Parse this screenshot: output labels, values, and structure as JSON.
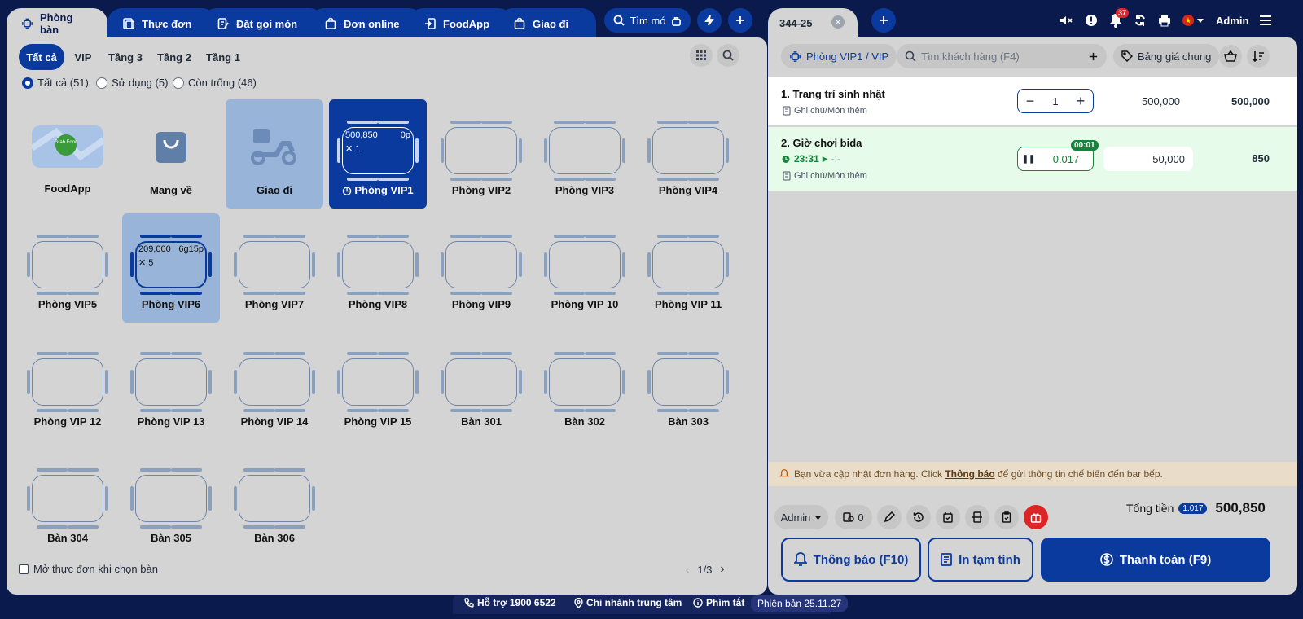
{
  "top_tabs": [
    {
      "label": "Phòng bàn",
      "icon": "table-layout-icon"
    },
    {
      "label": "Thực đơn",
      "icon": "menu-icon"
    },
    {
      "label": "Đặt gọi món",
      "icon": "order-icon"
    },
    {
      "label": "Đơn online",
      "icon": "bag-icon"
    },
    {
      "label": "FoodApp",
      "icon": "foodapp-icon"
    },
    {
      "label": "Giao đi",
      "icon": "delivery-icon"
    }
  ],
  "search_button": {
    "label": "Tìm mó"
  },
  "filter_tabs": [
    "Tất cả",
    "VIP",
    "Tầng 3",
    "Tầng 2",
    "Tầng 1"
  ],
  "status_filters": [
    {
      "label": "Tất cả (51)",
      "selected": true
    },
    {
      "label": "Sử dụng (5)",
      "selected": false
    },
    {
      "label": "Còn trống (46)",
      "selected": false
    }
  ],
  "special_tiles": [
    {
      "label": "FoodApp",
      "logo_text": "Grab Food"
    },
    {
      "label": "Mang về"
    },
    {
      "label": "Giao đi"
    }
  ],
  "tables": [
    {
      "label": "Phòng VIP1",
      "amount": "500,850",
      "time": "0p",
      "guests": "1",
      "state": "active"
    },
    {
      "label": "Phòng VIP2"
    },
    {
      "label": "Phòng VIP3"
    },
    {
      "label": "Phòng VIP4"
    },
    {
      "label": "Phòng VIP5"
    },
    {
      "label": "Phòng VIP6",
      "amount": "209,000",
      "time": "6g15p",
      "guests": "5",
      "state": "occupied"
    },
    {
      "label": "Phòng VIP7"
    },
    {
      "label": "Phòng VIP8"
    },
    {
      "label": "Phòng VIP9"
    },
    {
      "label": "Phòng VIP 10"
    },
    {
      "label": "Phòng VIP 11"
    },
    {
      "label": "Phòng VIP 12"
    },
    {
      "label": "Phòng VIP 13"
    },
    {
      "label": "Phòng VIP 14"
    },
    {
      "label": "Phòng VIP 15"
    },
    {
      "label": "Bàn 301"
    },
    {
      "label": "Bàn 302"
    },
    {
      "label": "Bàn 303"
    },
    {
      "label": "Bàn 304"
    },
    {
      "label": "Bàn 305"
    },
    {
      "label": "Bàn 306"
    }
  ],
  "open_menu_checkbox": {
    "label": "Mở thực đơn khi chọn bàn",
    "checked": false
  },
  "pagination": {
    "label": "1/3"
  },
  "order_tab": {
    "label": "344-25"
  },
  "header_right": {
    "notification_count": "37",
    "user": "Admin"
  },
  "order_bar": {
    "room": "Phòng VIP1 / VIP",
    "customer_search_placeholder": "Tìm khách hàng (F4)",
    "price_list": "Bảng giá chung"
  },
  "order_items": [
    {
      "name": "1. Trang trí sinh nhật",
      "note": "Ghi chú/Món thêm",
      "qty": "1",
      "price": "500,000",
      "total": "500,000"
    },
    {
      "name": "2. Giờ chơi bida",
      "note": "Ghi chú/Món thêm",
      "qty": "0.017",
      "timer_badge": "00:01",
      "start_time": "23:31",
      "end_time": "-:-",
      "price": "50,000",
      "total": "850"
    }
  ],
  "notice": {
    "prefix": "Bạn vừa cập nhật đơn hàng. Click ",
    "link": "Thông báo",
    "suffix": " để gửi thông tin chế biến đến bar bếp."
  },
  "toolbar": {
    "staff": "Admin",
    "guest_count": "0"
  },
  "summary": {
    "label": "Tổng tiền",
    "count": "1.017",
    "total": "500,850"
  },
  "actions": {
    "notify": "Thông báo (F10)",
    "print": "In tạm tính",
    "pay": "Thanh toán (F9)"
  },
  "footer": {
    "support": "Hỗ trợ 1900 6522",
    "branch": "Chi nhánh trung tâm",
    "shortcuts": "Phím tắt",
    "version": "Phiên bản 25.11.27"
  },
  "colors": {
    "primary": "#0a3a9e",
    "background": "#0b1a4d",
    "panel": "#d4d4d4",
    "highlight": "#98b4d8",
    "timer_green": "#16833a",
    "danger": "#dc2626"
  }
}
